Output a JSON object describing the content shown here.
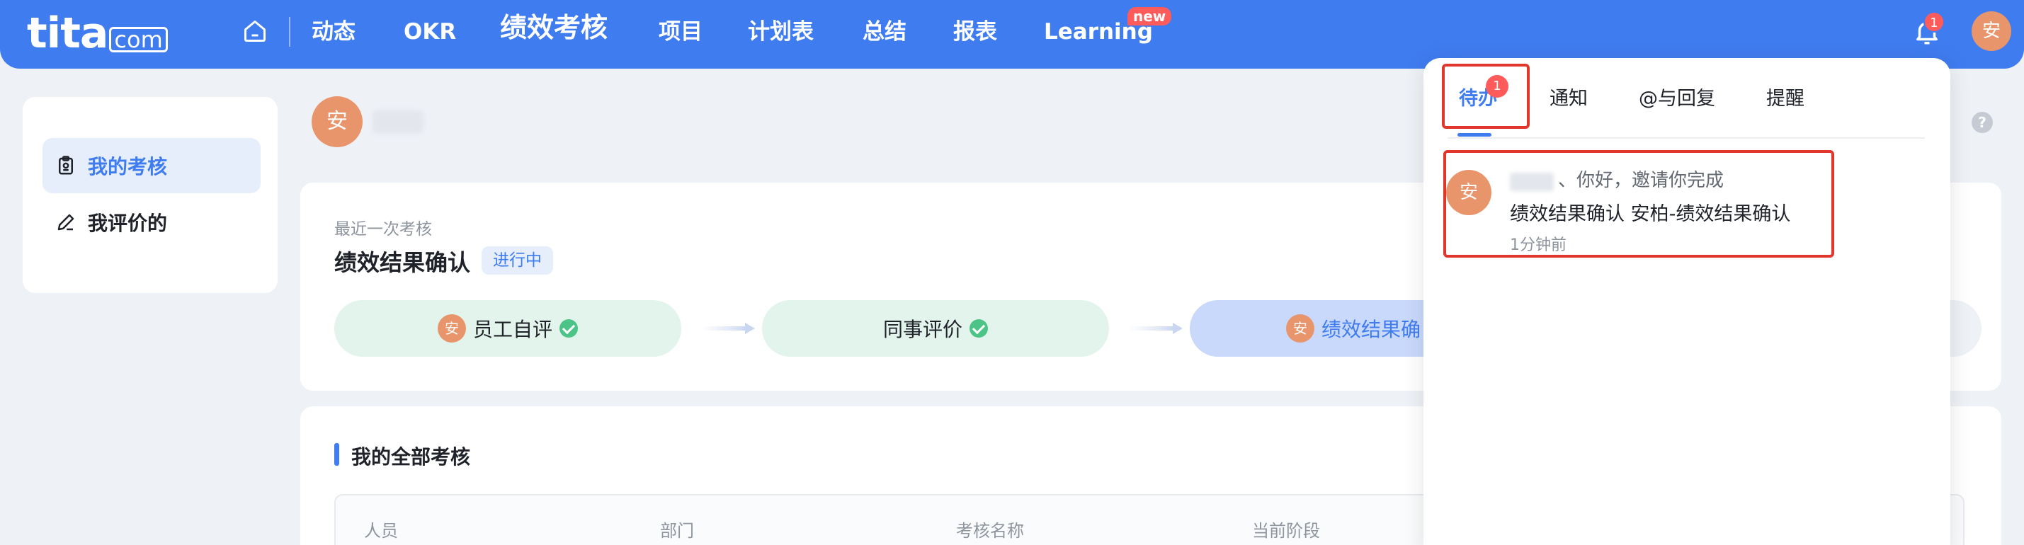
{
  "logo": {
    "main": "tita",
    "suffix": "com"
  },
  "nav": {
    "items": [
      "动态",
      "OKR",
      "绩效考核",
      "项目",
      "计划表",
      "总结",
      "报表",
      "Learning"
    ],
    "learning_badge": "new",
    "bell_count": "1",
    "user_avatar": "安"
  },
  "sidebar": {
    "items": [
      {
        "label": "我的考核"
      },
      {
        "label": "我评价的"
      }
    ]
  },
  "main": {
    "avatar": "安",
    "help": "?",
    "recent_label": "最近一次考核",
    "review_title": "绩效结果确认",
    "status": "进行中",
    "stages": [
      {
        "avatar": "安",
        "label": "员工自评"
      },
      {
        "label": "同事评价"
      },
      {
        "avatar": "安",
        "label": "绩效结果确"
      }
    ],
    "section_title": "我的全部考核",
    "table_headers": [
      "人员",
      "部门",
      "考核名称",
      "当前阶段"
    ]
  },
  "panel": {
    "tabs": [
      "待办",
      "通知",
      "@与回复",
      "提醒"
    ],
    "todo_badge": "1",
    "notification": {
      "avatar": "安",
      "greeting": "、你好，邀请你完成",
      "content": "绩效结果确认 安柏-绩效结果确认",
      "time": "1分钟前"
    }
  },
  "colors": {
    "primary": "#3f7cf0",
    "avatar": "#e9956c",
    "badge": "#ff5b5b",
    "highlight_box": "#e0362b",
    "done_stage": "#e3f4ec",
    "check": "#4cc488"
  }
}
